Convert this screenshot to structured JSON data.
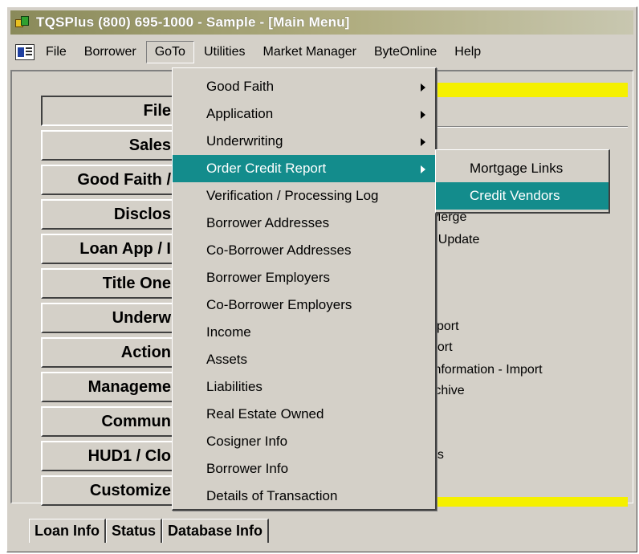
{
  "window": {
    "title": "TQSPlus (800) 695-1000 - Sample - [Main Menu]"
  },
  "menubar": {
    "items": [
      {
        "label": "File"
      },
      {
        "label": "Borrower"
      },
      {
        "label": "GoTo"
      },
      {
        "label": "Utilities"
      },
      {
        "label": "Market Manager"
      },
      {
        "label": "ByteOnline"
      },
      {
        "label": "Help"
      }
    ]
  },
  "left_buttons": [
    {
      "label": "File"
    },
    {
      "label": "Sales"
    },
    {
      "label": "Good Faith /"
    },
    {
      "label": "Disclos"
    },
    {
      "label": "Loan App / I"
    },
    {
      "label": "Title One"
    },
    {
      "label": "Underw"
    },
    {
      "label": "Action"
    },
    {
      "label": "Manageme"
    },
    {
      "label": "Commun"
    },
    {
      "label": "HUD1 / Clo"
    },
    {
      "label": "Customize"
    }
  ],
  "right_panel": {
    "lines": [
      "Merge",
      "- Update",
      "xport",
      "port",
      "Information - Import",
      "rchive",
      "ns"
    ]
  },
  "goto_menu": {
    "items": [
      {
        "label": "Good Faith",
        "submenu": true
      },
      {
        "label": "Application",
        "submenu": true
      },
      {
        "label": "Underwriting",
        "submenu": true
      },
      {
        "label": "Order Credit Report",
        "submenu": true
      },
      {
        "label": "Verification / Processing Log",
        "submenu": false
      },
      {
        "label": "Borrower Addresses",
        "submenu": false
      },
      {
        "label": "Co-Borrower Addresses",
        "submenu": false
      },
      {
        "label": "Borrower Employers",
        "submenu": false
      },
      {
        "label": "Co-Borrower Employers",
        "submenu": false
      },
      {
        "label": "Income",
        "submenu": false
      },
      {
        "label": "Assets",
        "submenu": false
      },
      {
        "label": "Liabilities",
        "submenu": false
      },
      {
        "label": "Real Estate Owned",
        "submenu": false
      },
      {
        "label": "Cosigner Info",
        "submenu": false
      },
      {
        "label": "Borrower Info",
        "submenu": false
      },
      {
        "label": "Details of Transaction",
        "submenu": false
      }
    ]
  },
  "credit_submenu": {
    "items": [
      {
        "label": "Mortgage Links"
      },
      {
        "label": "Credit Vendors"
      }
    ]
  },
  "tabs": [
    {
      "label": "Loan Info"
    },
    {
      "label": "Status"
    },
    {
      "label": "Database Info"
    }
  ],
  "colors": {
    "highlight": "#138c8c",
    "yellow_bar": "#f5f000",
    "face": "#d4d0c8"
  }
}
